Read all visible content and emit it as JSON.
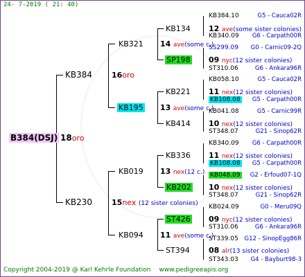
{
  "date": "24-  7-2019 (  21:  40)",
  "root": "B384(DSJ)",
  "footer": {
    "copyright": "Copyright 2004-2019 @ Karl Kehrle Foundation",
    "site": "www.pedigreeapis.org"
  },
  "gen1": [
    {
      "name": "KB384",
      "num": "16",
      "tag": "oro",
      "extra": ""
    },
    {
      "name": "KB230",
      "num": "15",
      "tag": "nex",
      "extra": "(12 sister colonies)"
    }
  ],
  "root_num": "18",
  "root_tag": "oro",
  "gen2": [
    {
      "name": "KB321",
      "num": "14",
      "tag": "ave",
      "extra": "(some c.)"
    },
    {
      "name": "KB195",
      "num": "13",
      "tag": "ave",
      "extra": "(some c.)"
    },
    {
      "name": "KB019",
      "num": "13",
      "tag": "nex",
      "extra": "(12 c.)"
    },
    {
      "name": "KB094",
      "num": "11",
      "tag": "ave",
      "extra": "(some c.)"
    }
  ],
  "gen3": [
    {
      "name": "KB134",
      "num": "12",
      "tag": "ave",
      "extra": "(some sister colonies)"
    },
    {
      "name": "SP198",
      "num": "09",
      "tag": "nyc",
      "extra": "(12 sister colonies)"
    },
    {
      "name": "KB221",
      "num": "11",
      "tag": "nex",
      "extra": "(12 sister colonies)"
    },
    {
      "name": "KB414",
      "num": "10",
      "tag": "nex",
      "extra": "(12 sister colonies)"
    },
    {
      "name": "KB336",
      "num": "11",
      "tag": "nex",
      "extra": "(12 sister colonies)"
    },
    {
      "name": "KB202",
      "num": "10",
      "tag": "nex",
      "extra": "(12 sister colonies)"
    },
    {
      "name": "ST426",
      "num": "09",
      "tag": "nyc",
      "extra": "(12 sister colonies)"
    },
    {
      "name": "ST394",
      "num": "08",
      "tag": "alr",
      "extra": "(13 sister colonies)"
    }
  ],
  "gen4": [
    {
      "name": "KB384.10",
      "info": "G5 - Cauca02R"
    },
    {
      "name": "KB340.09",
      "info": "G6 - Carpath00R"
    },
    {
      "name": "SS299.09",
      "info": "G0 - Carnic09-2Q"
    },
    {
      "name": "ST310.06",
      "info": "G6 - Ankara96R"
    },
    {
      "name": "KB058.10",
      "info": "G5 - Cauca02R"
    },
    {
      "name": "KB108.08",
      "info": "G5 - Carpath00R"
    },
    {
      "name": "KB041.08",
      "info": "G5 - Carnic99R"
    },
    {
      "name": "ST348.07",
      "info": "G21 - Sinop62R"
    },
    {
      "name": "KB340.09",
      "info": "G6 - Carpath00R"
    },
    {
      "name": "KB108.08",
      "info": "G5 - Carpath00R"
    },
    {
      "name": "KB048.09",
      "info": "G2 - Erfoud07-1Q"
    },
    {
      "name": "ST348.07",
      "info": "G21 - Sinop62R"
    },
    {
      "name": "KB024.09",
      "info": "G0 - Meru09Q"
    },
    {
      "name": "ST310.06",
      "info": "G6 - Ankara96R"
    },
    {
      "name": "ST339.05",
      "info": "G12 - SinopEgg86R"
    },
    {
      "name": "ST343.03",
      "info": "G4 - Bayburt98-3"
    }
  ]
}
